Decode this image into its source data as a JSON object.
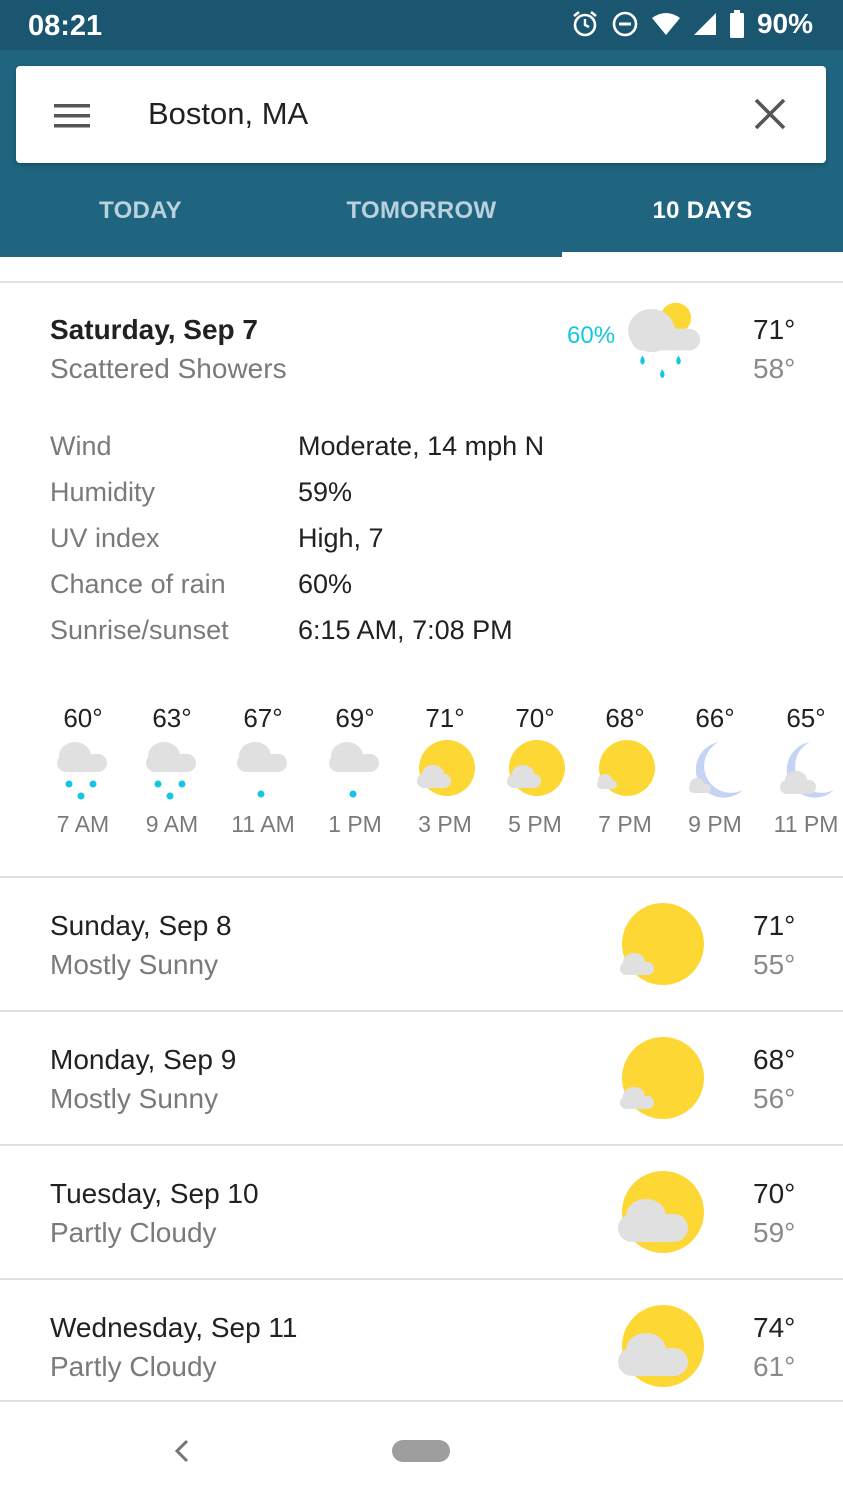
{
  "status_bar": {
    "time": "08:21",
    "battery": "90%"
  },
  "search": {
    "location": "Boston, MA"
  },
  "tabs": [
    {
      "label": "TODAY",
      "active": false
    },
    {
      "label": "TOMORROW",
      "active": false
    },
    {
      "label": "10 DAYS",
      "active": true
    }
  ],
  "expanded_day": {
    "title": "Saturday, Sep 7",
    "condition": "Scattered Showers",
    "precip": "60%",
    "high": "71°",
    "low": "58°",
    "icon": "rain-cloud-sun-icon",
    "details": [
      {
        "label": "Wind",
        "value": "Moderate, 14 mph N"
      },
      {
        "label": "Humidity",
        "value": "59%"
      },
      {
        "label": "UV index",
        "value": "High, 7"
      },
      {
        "label": "Chance of rain",
        "value": "60%"
      },
      {
        "label": "Sunrise/sunset",
        "value": "6:15 AM, 7:08 PM"
      }
    ],
    "hourly": [
      {
        "temp": "60°",
        "time": "7 AM",
        "icon": "cloud-rain-icon"
      },
      {
        "temp": "63°",
        "time": "9 AM",
        "icon": "cloud-rain-icon"
      },
      {
        "temp": "67°",
        "time": "11 AM",
        "icon": "cloud-drizzle-icon"
      },
      {
        "temp": "69°",
        "time": "1 PM",
        "icon": "cloud-drizzle-icon"
      },
      {
        "temp": "71°",
        "time": "3 PM",
        "icon": "sun-cloud-icon"
      },
      {
        "temp": "70°",
        "time": "5 PM",
        "icon": "sun-cloud-icon"
      },
      {
        "temp": "68°",
        "time": "7 PM",
        "icon": "sun-small-cloud-icon"
      },
      {
        "temp": "66°",
        "time": "9 PM",
        "icon": "moon-cloud-icon"
      },
      {
        "temp": "65°",
        "time": "11 PM",
        "icon": "moon-cloud-icon"
      }
    ]
  },
  "days": [
    {
      "title": "Sunday, Sep 8",
      "condition": "Mostly Sunny",
      "high": "71°",
      "low": "55°",
      "icon": "mostly-sunny-icon"
    },
    {
      "title": "Monday, Sep 9",
      "condition": "Mostly Sunny",
      "high": "68°",
      "low": "56°",
      "icon": "mostly-sunny-icon"
    },
    {
      "title": "Tuesday, Sep 10",
      "condition": "Partly Cloudy",
      "high": "70°",
      "low": "59°",
      "icon": "partly-cloudy-icon"
    },
    {
      "title": "Wednesday, Sep 11",
      "condition": "Partly Cloudy",
      "high": "74°",
      "low": "61°",
      "icon": "partly-cloudy-icon"
    }
  ],
  "colors": {
    "header": "#1f6580",
    "status_bar": "#1a5670",
    "sun": "#fdd835",
    "cloud": "#e0e0e0",
    "rain": "#14c6e3",
    "moon": "#c5d3f5"
  }
}
